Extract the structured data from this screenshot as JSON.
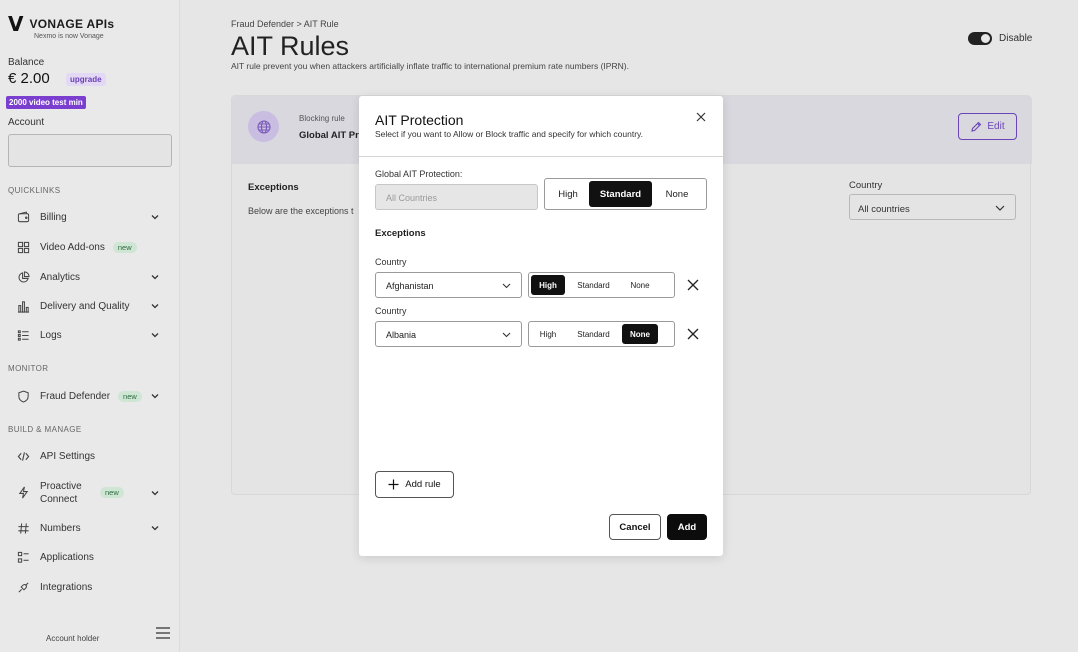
{
  "sidebar": {
    "brand": {
      "logo_glyph": "V",
      "name": "VONAGE APIs",
      "sub": "Nexmo is now Vonage"
    },
    "balance_label": "Balance",
    "balance_value": "€ 2.00",
    "upgrade_label": "upgrade",
    "video_badge": "2000 video test min",
    "account_label": "Account",
    "quicklinks_heading": "QUICKLINKS",
    "monitor_heading": "MONITOR",
    "build_heading": "BUILD & MANAGE",
    "items": [
      {
        "label": "Billing",
        "icon": "wallet-icon",
        "chevron": true
      },
      {
        "label": "Video Add-ons",
        "icon": "grid-icon",
        "badge": "new"
      },
      {
        "label": "Analytics",
        "icon": "pie-chart-icon",
        "chevron": true
      },
      {
        "label": "Delivery and Quality",
        "icon": "bar-chart-icon",
        "chevron": true
      },
      {
        "label": "Logs",
        "icon": "list-icon",
        "chevron": true
      },
      {
        "label": "Fraud Defender",
        "icon": "shield-icon",
        "badge": "new",
        "chevron": true
      },
      {
        "label": "API Settings",
        "icon": "code-icon"
      },
      {
        "label": "Proactive Connect",
        "icon": "lightning-icon",
        "badge": "new",
        "chevron": true
      },
      {
        "label": "Numbers",
        "icon": "hash-icon",
        "chevron": true
      },
      {
        "label": "Applications",
        "icon": "apps-icon"
      },
      {
        "label": "Integrations",
        "icon": "plug-icon"
      }
    ],
    "account_holder": "Account holder"
  },
  "main": {
    "breadcrumb": "Fraud Defender > AIT Rule",
    "title": "AIT Rules",
    "description": "AIT rule prevent you when attackers artificially inflate traffic to international premium rate numbers (IPRN).",
    "toggle_label": "Disable",
    "card": {
      "blocking_label": "Blocking rule",
      "blocking_name": "Global AIT Pr",
      "edit_label": "Edit",
      "exceptions_title": "Exceptions",
      "exceptions_desc": "Below are the exceptions t",
      "country_label": "Country",
      "country_value": "All countries"
    }
  },
  "modal": {
    "title": "AIT Protection",
    "subtitle": "Select if you want to Allow or Block traffic and specify for which country.",
    "global_label": "Global AIT Protection:",
    "global_placeholder": "All Countries",
    "levels": [
      "High",
      "Standard",
      "None"
    ],
    "global_selected": "Standard",
    "exceptions_label": "Exceptions",
    "rows": [
      {
        "country_label": "Country",
        "country": "Afghanistan",
        "selected": "High"
      },
      {
        "country_label": "Country",
        "country": "Albania",
        "selected": "None"
      }
    ],
    "add_rule_label": "Add rule",
    "cancel_label": "Cancel",
    "add_label": "Add"
  },
  "colors": {
    "accent": "#6a45b8",
    "selected": "#111111",
    "new_badge_bg": "#cfe6d4"
  }
}
